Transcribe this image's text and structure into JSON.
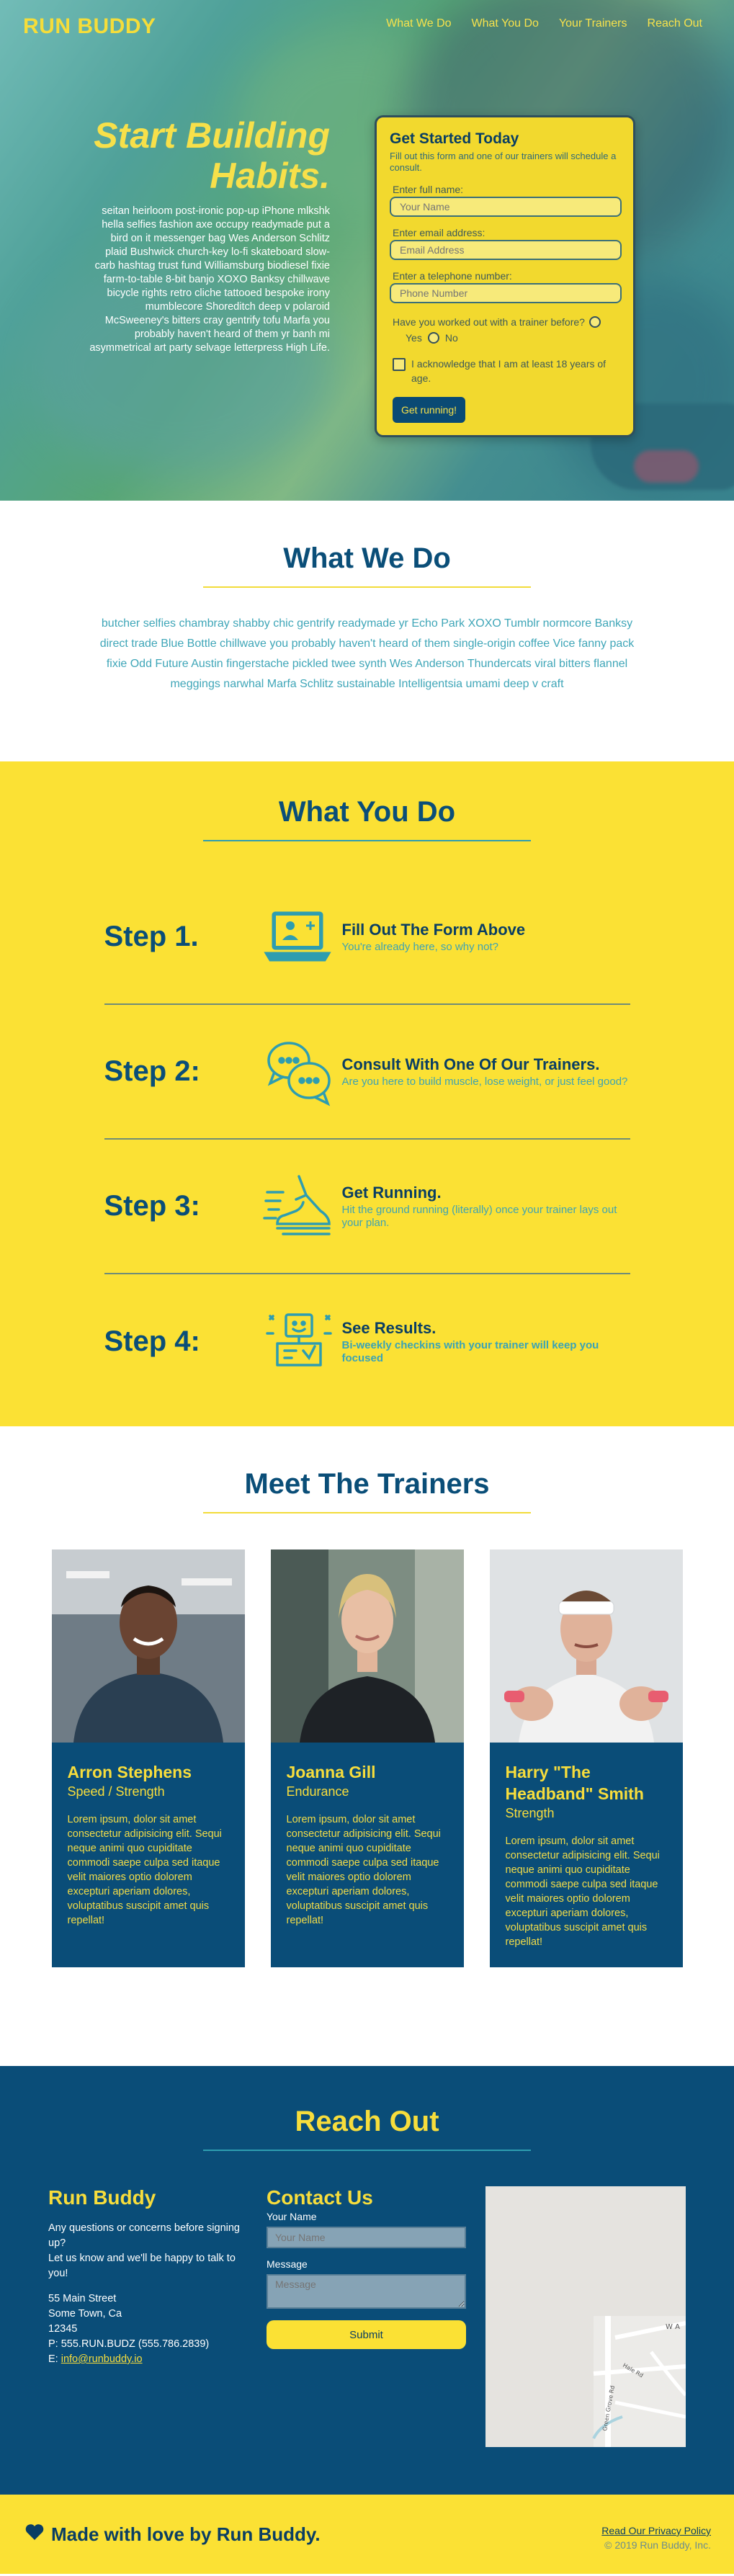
{
  "brand": {
    "logo": "RUN BUDDY"
  },
  "nav": {
    "items": [
      "What We Do",
      "What You Do",
      "Your Trainers",
      "Reach Out"
    ]
  },
  "hero": {
    "title": "Start Building Habits.",
    "text": "seitan heirloom post-ironic pop-up iPhone mlkshk hella selfies fashion axe occupy readymade put a bird on it messenger bag Wes Anderson Schlitz plaid Bushwick church-key lo-fi skateboard slow-carb hashtag trust fund Williamsburg biodiesel fixie farm-to-table 8-bit banjo XOXO Banksy chillwave bicycle rights retro cliche tattooed bespoke irony mumblecore Shoreditch deep v polaroid McSweeney's bitters cray gentrify tofu Marfa you probably haven't heard of them yr banh mi asymmetrical art party selvage letterpress High Life."
  },
  "form": {
    "title": "Get Started Today",
    "subtitle": "Fill out this form and one of our trainers will schedule a consult.",
    "name_label": "Enter full name:",
    "name_placeholder": "Your Name",
    "email_label": "Enter email address:",
    "email_placeholder": "Email Address",
    "phone_label": "Enter a telephone number:",
    "phone_placeholder": "Phone Number",
    "question": "Have you worked out with a trainer before?",
    "yes": "Yes",
    "no": "No",
    "age_check": "I acknowledge that I am at least 18 years of age.",
    "submit": "Get running!"
  },
  "what_we_do": {
    "title": "What We Do",
    "text": "butcher selfies chambray shabby chic gentrify readymade yr Echo Park XOXO Tumblr normcore Banksy direct trade Blue Bottle chillwave you probably haven't heard of them single-origin coffee Vice fanny pack fixie Odd Future Austin fingerstache pickled twee synth Wes Anderson Thundercats viral bitters flannel meggings narwhal Marfa Schlitz sustainable Intelligentsia umami deep v craft"
  },
  "what_you_do": {
    "title": "What You Do",
    "steps": [
      {
        "num": "Step 1.",
        "icon": "laptop-user-icon",
        "title": "Fill Out The Form Above",
        "desc": "You're already here, so why not?"
      },
      {
        "num": "Step 2:",
        "icon": "chat-bubbles-icon",
        "title": "Consult With One Of Our Trainers.",
        "desc": "Are you here to build muscle, lose weight, or just feel good?"
      },
      {
        "num": "Step 3:",
        "icon": "running-shoe-icon",
        "title": "Get Running.",
        "desc": "Hit the ground running (literally) once your trainer lays out your plan."
      },
      {
        "num": "Step 4:",
        "icon": "results-dashboard-icon",
        "title": "See Results.",
        "desc": "Bi-weekly checkins with your trainer will keep you focused"
      }
    ]
  },
  "trainers": {
    "title": "Meet The Trainers",
    "list": [
      {
        "name": "Arron Stephens",
        "specialty": "Speed / Strength",
        "bio": "Lorem ipsum, dolor sit amet consectetur adipisicing elit. Sequi neque animi quo cupiditate commodi saepe culpa sed itaque velit maiores optio dolorem excepturi aperiam dolores, voluptatibus suscipit amet quis repellat!"
      },
      {
        "name": "Joanna Gill",
        "specialty": "Endurance",
        "bio": "Lorem ipsum, dolor sit amet consectetur adipisicing elit. Sequi neque animi quo cupiditate commodi saepe culpa sed itaque velit maiores optio dolorem excepturi aperiam dolores, voluptatibus suscipit amet quis repellat!"
      },
      {
        "name": "Harry \"The Headband\" Smith",
        "specialty": "Strength",
        "bio": "Lorem ipsum, dolor sit amet consectetur adipisicing elit. Sequi neque animi quo cupiditate commodi saepe culpa sed itaque velit maiores optio dolorem excepturi aperiam dolores, voluptatibus suscipit amet quis repellat!"
      }
    ]
  },
  "reach": {
    "title": "Reach Out",
    "brand": "Run Buddy",
    "intro": "Any questions or concerns before signing up?",
    "intro2": "Let us know and we'll be happy to talk to you!",
    "address1": "55 Main Street",
    "address2": "Some Town, Ca",
    "address3": "12345",
    "phone": "P: 555.RUN.BUDZ (555.786.2839)",
    "email_prefix": "E: ",
    "email": "info@runbuddy.io",
    "contact_title": "Contact Us",
    "name_label": "Your Name",
    "name_placeholder": "Your Name",
    "message_label": "Message",
    "message_placeholder": "Message",
    "submit": "Submit",
    "map_labels": [
      "W A",
      "Hale Rd",
      "Green Grove Rd"
    ]
  },
  "footer": {
    "love": "Made with love by Run Buddy.",
    "policy": "Read Our Privacy Policy",
    "copyright": "© 2019 Run Buddy, Inc."
  },
  "colors": {
    "navy": "#0a4d78",
    "yellow": "#fbe134",
    "teal": "#3fa6b8"
  }
}
